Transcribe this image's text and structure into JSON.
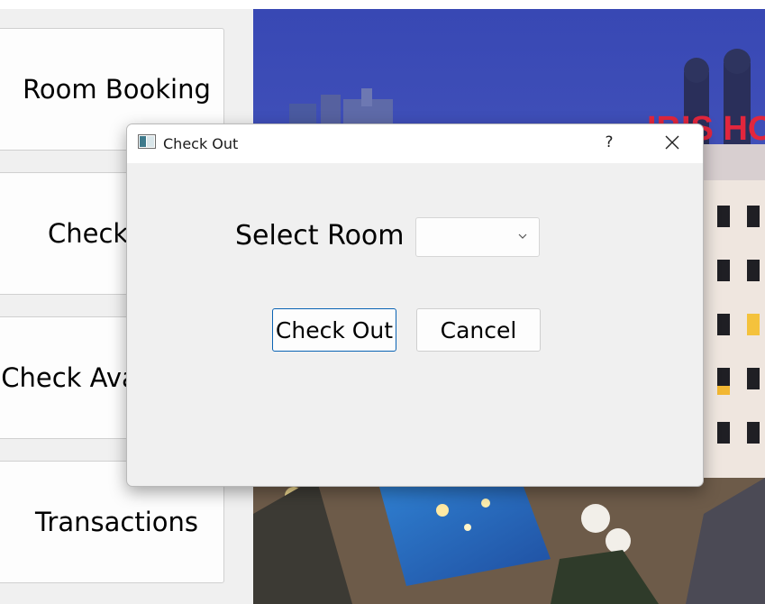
{
  "sidebar": {
    "items": [
      {
        "label": "Room Booking"
      },
      {
        "label": "Check-Out"
      },
      {
        "label": "Check Availability"
      },
      {
        "label": "Transactions"
      }
    ]
  },
  "background": {
    "hotel_sign": "IBIS HOTEL"
  },
  "dialog": {
    "title": "Check Out",
    "help_symbol": "?",
    "select_room_label": "Select Room",
    "room_combo_value": "",
    "check_out_label": "Check Out",
    "cancel_label": "Cancel"
  },
  "colors": {
    "dialog_bg": "#f0f0f0",
    "titlebar_bg": "#ffffff",
    "primary_border": "#0a63b4",
    "sky": "#3d4fb6",
    "hotel_sign": "#e2263d"
  }
}
